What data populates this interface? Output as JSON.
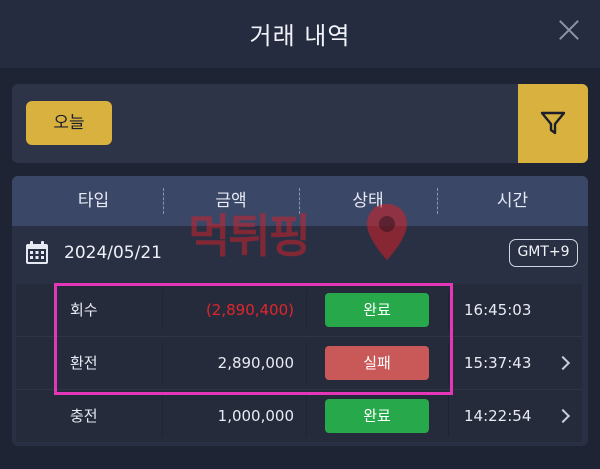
{
  "header": {
    "title": "거래 내역"
  },
  "filter": {
    "today_label": "오늘"
  },
  "table": {
    "columns": [
      "타입",
      "금액",
      "상태",
      "시간"
    ],
    "date": "2024/05/21",
    "timezone": "GMT+9",
    "rows": [
      {
        "type": "회수",
        "amount": "(2,890,400)",
        "status": "완료",
        "time": "16:45:03",
        "has_arrow": false,
        "amount_color": "#e0262b",
        "status_color": "#27a84a"
      },
      {
        "type": "환전",
        "amount": "2,890,000",
        "status": "실패",
        "time": "15:37:43",
        "has_arrow": true,
        "amount_color": "#e8ebf3",
        "status_color": "#c95858"
      },
      {
        "type": "충전",
        "amount": "1,000,000",
        "status": "완료",
        "time": "14:22:54",
        "has_arrow": true,
        "amount_color": "#e8ebf3",
        "status_color": "#27a84a"
      }
    ]
  },
  "watermark": {
    "text": "먹튀핑"
  },
  "colors": {
    "accent": "#d8b13e",
    "highlight": "#e636b8",
    "header_bg": "#3b4767"
  }
}
